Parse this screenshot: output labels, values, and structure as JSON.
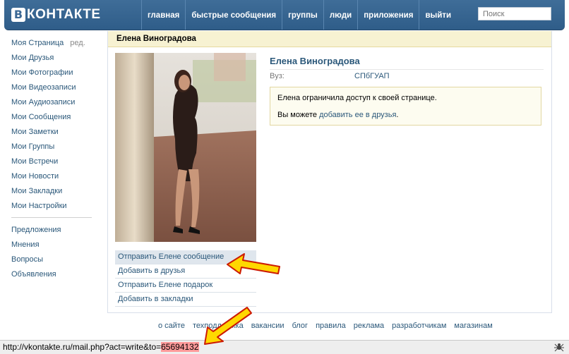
{
  "header": {
    "logo_letter": "В",
    "logo_text": "КОНТАКТЕ",
    "nav": [
      "главная",
      "быстрые сообщения",
      "группы",
      "люди",
      "приложения",
      "выйти"
    ],
    "search_placeholder": "Поиск"
  },
  "left_menu": {
    "main": [
      "Моя Страница",
      "Мои Друзья",
      "Мои Фотографии",
      "Мои Видеозаписи",
      "Мои Аудиозаписи",
      "Мои Сообщения",
      "Мои Заметки",
      "Мои Группы",
      "Мои Встречи",
      "Мои Новости",
      "Мои Закладки",
      "Мои Настройки"
    ],
    "edit_label": "ред.",
    "extra": [
      "Предложения",
      "Мнения",
      "Вопросы",
      "Объявления"
    ]
  },
  "profile": {
    "header_name": "Елена Виноградова",
    "name": "Елена Виноградова",
    "uni_label": "Вуз:",
    "uni_value": "СПбГУАП",
    "notice_line1": "Елена ограничила доступ к своей странице.",
    "notice_prefix": "Вы можете ",
    "notice_link": "добавить ее в друзья",
    "notice_suffix": ".",
    "actions": [
      "Отправить Елене сообщение",
      "Добавить в друзья",
      "Отправить Елене подарок",
      "Добавить в закладки"
    ]
  },
  "footer": [
    "о сайте",
    "техподдержка",
    "вакансии",
    "блог",
    "правила",
    "реклама",
    "разработчикам",
    "магазинам"
  ],
  "statusbar": {
    "url_prefix": "http://vkontakte.ru/mail.php?act=write&to=",
    "user_id": "65694132"
  },
  "colors": {
    "header": "#365f8a",
    "link": "#2b587a",
    "profile_header_bg": "#f7f2d2",
    "notice_bg": "#fdfcf0",
    "highlight_id": "#ff9a9a",
    "arrow_fill": "#ffd800",
    "arrow_stroke": "#cc1a00"
  }
}
